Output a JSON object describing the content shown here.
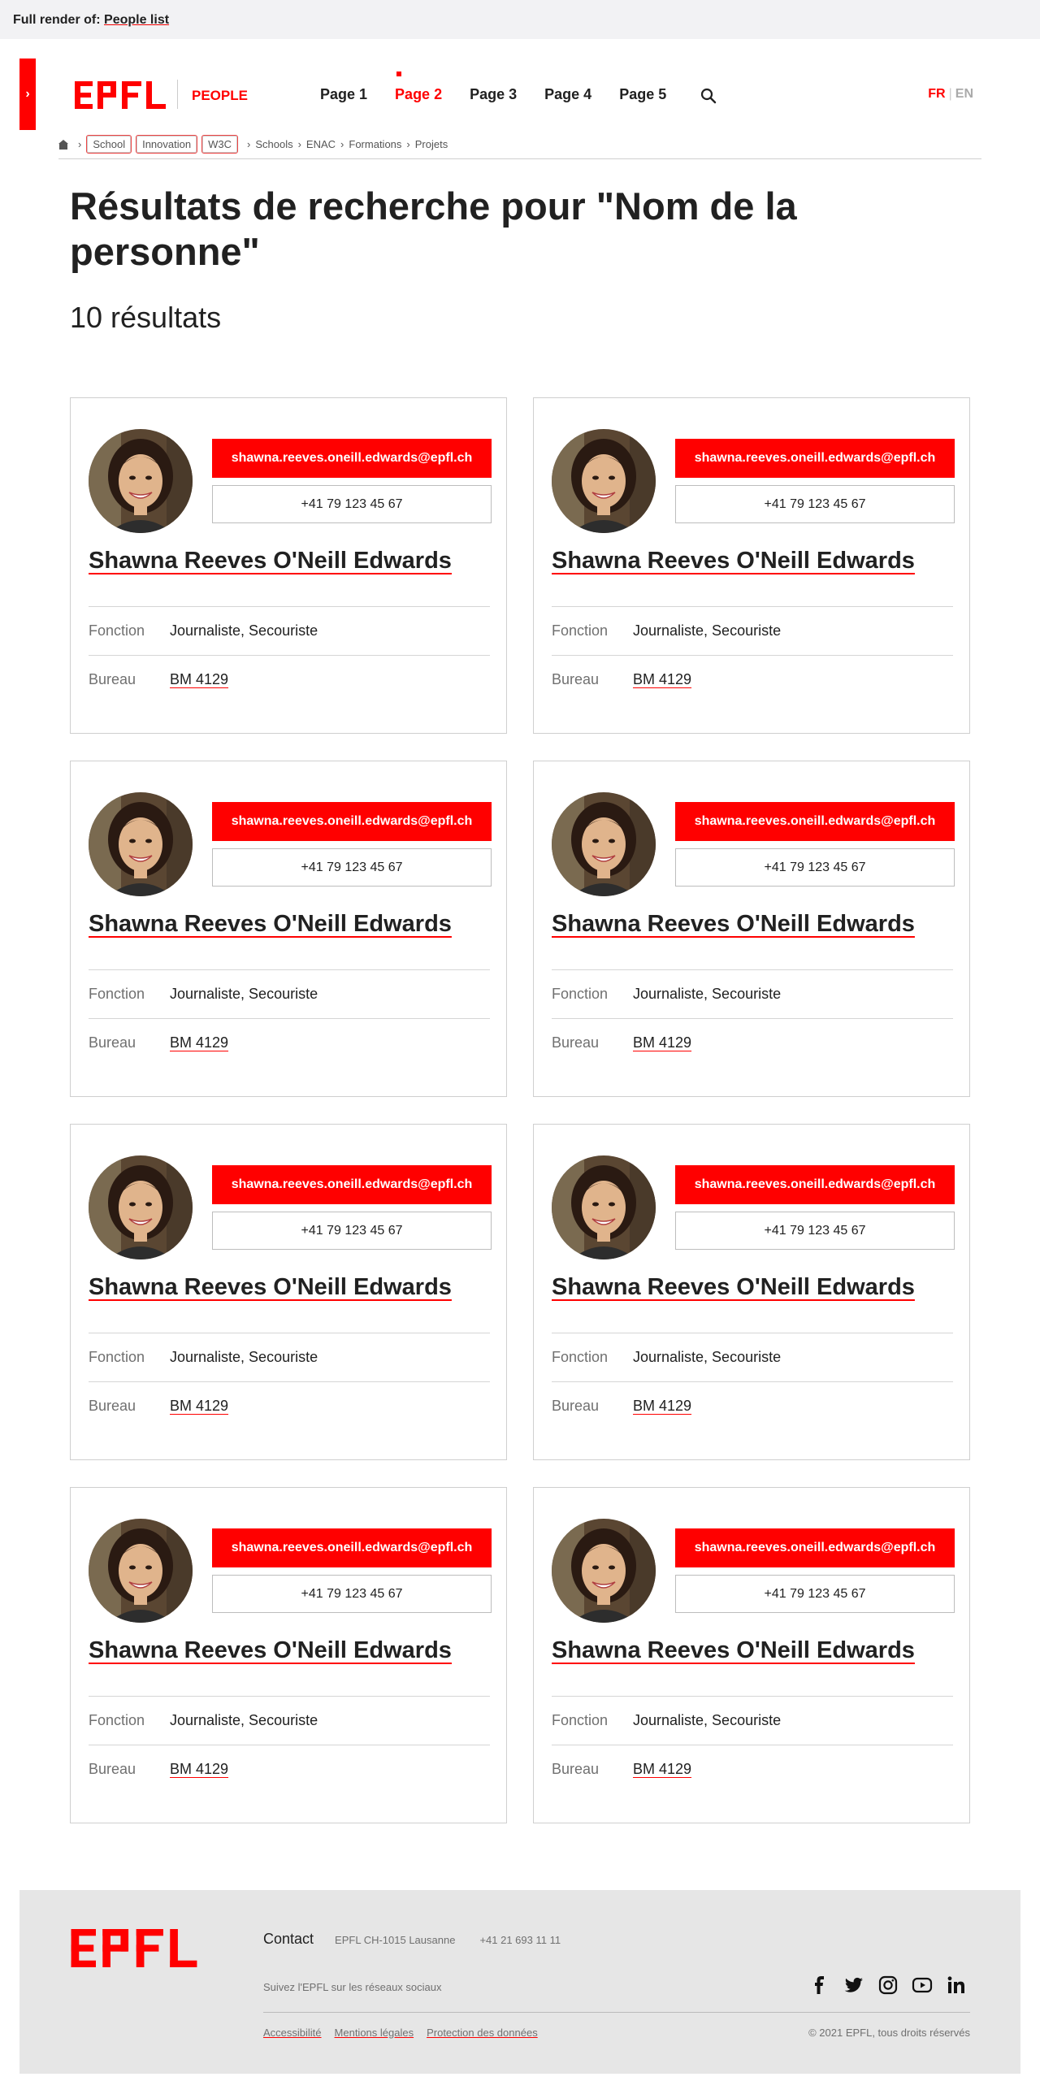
{
  "render_bar": {
    "prefix": "Full render of:",
    "link": "People list"
  },
  "drawer": {
    "icon": "chevron-right"
  },
  "header": {
    "logo_text": "EPFL",
    "site_title": "PEOPLE",
    "nav": [
      "Page 1",
      "Page 2",
      "Page 3",
      "Page 4",
      "Page 5"
    ],
    "active_nav": "Page 2",
    "lang_active": "FR",
    "lang_other": "EN"
  },
  "breadcrumb": {
    "tags": [
      "School",
      "Innovation",
      "W3C"
    ],
    "links": [
      "Schools",
      "ENAC",
      "Formations",
      "Projets"
    ]
  },
  "page": {
    "title": "Résultats de recherche pour \"Nom de la personne\"",
    "result_count": "10 résultats"
  },
  "labels": {
    "fonction": "Fonction",
    "bureau": "Bureau"
  },
  "people": [
    {
      "name": "Shawna Reeves O'Neill Edwards",
      "email": "shawna.reeves.oneill.edwards@epfl.ch",
      "phone": "+41 79 123 45 67",
      "fonction": "Journaliste, Secouriste",
      "bureau": "BM 4129"
    },
    {
      "name": "Shawna Reeves O'Neill Edwards",
      "email": "shawna.reeves.oneill.edwards@epfl.ch",
      "phone": "+41 79 123 45 67",
      "fonction": "Journaliste, Secouriste",
      "bureau": "BM 4129"
    },
    {
      "name": "Shawna Reeves O'Neill Edwards",
      "email": "shawna.reeves.oneill.edwards@epfl.ch",
      "phone": "+41 79 123 45 67",
      "fonction": "Journaliste, Secouriste",
      "bureau": "BM 4129"
    },
    {
      "name": "Shawna Reeves O'Neill Edwards",
      "email": "shawna.reeves.oneill.edwards@epfl.ch",
      "phone": "+41 79 123 45 67",
      "fonction": "Journaliste, Secouriste",
      "bureau": "BM 4129"
    },
    {
      "name": "Shawna Reeves O'Neill Edwards",
      "email": "shawna.reeves.oneill.edwards@epfl.ch",
      "phone": "+41 79 123 45 67",
      "fonction": "Journaliste, Secouriste",
      "bureau": "BM 4129"
    },
    {
      "name": "Shawna Reeves O'Neill Edwards",
      "email": "shawna.reeves.oneill.edwards@epfl.ch",
      "phone": "+41 79 123 45 67",
      "fonction": "Journaliste, Secouriste",
      "bureau": "BM 4129"
    },
    {
      "name": "Shawna Reeves O'Neill Edwards",
      "email": "shawna.reeves.oneill.edwards@epfl.ch",
      "phone": "+41 79 123 45 67",
      "fonction": "Journaliste, Secouriste",
      "bureau": "BM 4129"
    },
    {
      "name": "Shawna Reeves O'Neill Edwards",
      "email": "shawna.reeves.oneill.edwards@epfl.ch",
      "phone": "+41 79 123 45 67",
      "fonction": "Journaliste, Secouriste",
      "bureau": "BM 4129"
    }
  ],
  "footer": {
    "logo_text": "EPFL",
    "contact_title": "Contact",
    "address": "EPFL CH-1015 Lausanne",
    "phone": "+41 21 693 11 11",
    "social_text": "Suivez l'EPFL sur les réseaux sociaux",
    "social_icons": [
      "facebook-icon",
      "twitter-icon",
      "instagram-icon",
      "youtube-icon",
      "linkedin-icon"
    ],
    "legal_links": [
      "Accessibilité",
      "Mentions légales",
      "Protection des données"
    ],
    "copyright": "© 2021 EPFL, tous droits réservés"
  },
  "colors": {
    "accent": "#ff0000",
    "text": "#212121",
    "muted": "#707070",
    "footer_bg": "#e6e6e6"
  }
}
